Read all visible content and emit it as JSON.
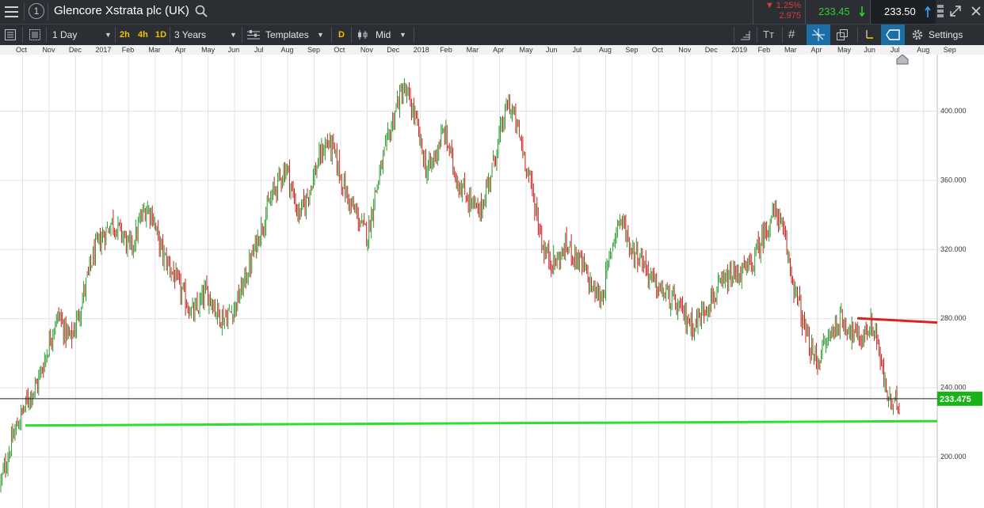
{
  "window": {
    "instrument_title": "Glencore Xstrata plc (UK)",
    "info_glyph": "1",
    "change_pct": "▼ 1.25%",
    "change_abs": "2.975",
    "bid": "233.45",
    "ask": "233.50",
    "colors": {
      "bg": "#2b2e33",
      "red": "#e03a3a",
      "green": "#2ed12e",
      "ask_bg": "#1c1f24"
    }
  },
  "toolbar": {
    "interval": "1 Day",
    "quick_2h": "2h",
    "quick_4h": "4h",
    "quick_1d": "1D",
    "range": "3 Years",
    "templates": "Templates",
    "d_button": "D",
    "price_type": "Mid",
    "settings": "Settings",
    "icons": [
      "hamburger-icon",
      "info-icon",
      "search-icon",
      "list-icon",
      "layout-icon",
      "templates-icon",
      "candle-icon",
      "ruler-icon",
      "text-icon",
      "hash-icon",
      "crosshair-icon",
      "copy-icon",
      "pointer-icon",
      "tag-icon",
      "gear-icon",
      "arrow-down-icon",
      "arrow-up-icon",
      "pin-icon",
      "expand-icon",
      "close-icon"
    ]
  },
  "months": [
    "Oct",
    "Nov",
    "Dec",
    "2017",
    "Feb",
    "Mar",
    "Apr",
    "May",
    "Jun",
    "Jul",
    "Aug",
    "Sep",
    "Oct",
    "Nov",
    "Dec",
    "2018",
    "Feb",
    "Mar",
    "Apr",
    "May",
    "Jun",
    "Jul",
    "Aug",
    "Sep",
    "Oct",
    "Nov",
    "Dec",
    "2019",
    "Feb",
    "Mar",
    "Apr",
    "May",
    "Jun",
    "Jul",
    "Aug",
    "Sep"
  ],
  "chart_data": {
    "type": "candlestick",
    "title": "Glencore Xstrata plc (UK)",
    "x_axis": "months Oct 2016 – Sep 2019",
    "y_ticks": [
      "200.000",
      "240.000",
      "280.000",
      "320.000",
      "360.000",
      "400.000"
    ],
    "ylim": [
      173,
      420
    ],
    "current_price": "233.475",
    "current_price_value": 233.475,
    "support_line": {
      "color": "#2ee02e",
      "from_value": 218,
      "to_value": 220.5
    },
    "resistance_line": {
      "color": "#e02020",
      "from_value": 280,
      "to_value": 277.5
    },
    "gridlines": true,
    "series": [
      {
        "name": "Close",
        "colors": {
          "up": "#2e9a2e",
          "down": "#c82020"
        },
        "values": [
          185,
          198,
          210,
          220,
          228,
          236,
          240,
          250,
          262,
          275,
          282,
          272,
          268,
          278,
          292,
          305,
          318,
          325,
          330,
          336,
          332,
          328,
          320,
          326,
          338,
          344,
          340,
          325,
          315,
          310,
          302,
          295,
          288,
          282,
          287,
          295,
          292,
          284,
          280,
          282,
          286,
          294,
          304,
          314,
          326,
          336,
          346,
          355,
          362,
          368,
          352,
          340,
          345,
          356,
          366,
          376,
          382,
          377,
          365,
          354,
          345,
          340,
          332,
          329,
          350,
          364,
          378,
          392,
          405,
          412,
          406,
          396,
          380,
          365,
          370,
          380,
          388,
          376,
          362,
          355,
          350,
          345,
          340,
          352,
          364,
          378,
          392,
          405,
          396,
          384,
          370,
          355,
          338,
          320,
          315,
          312,
          316,
          322,
          318,
          314,
          308,
          300,
          294,
          292,
          308,
          326,
          338,
          332,
          320,
          318,
          314,
          306,
          300,
          296,
          294,
          290,
          286,
          282,
          278,
          276,
          282,
          288,
          292,
          296,
          300,
          303,
          305,
          307,
          308,
          313,
          322,
          330,
          338,
          342,
          330,
          315,
          298,
          285,
          270,
          260,
          255,
          263,
          270,
          275,
          279,
          276,
          272,
          268,
          270,
          276,
          272,
          250,
          235,
          228,
          233
        ]
      }
    ]
  }
}
